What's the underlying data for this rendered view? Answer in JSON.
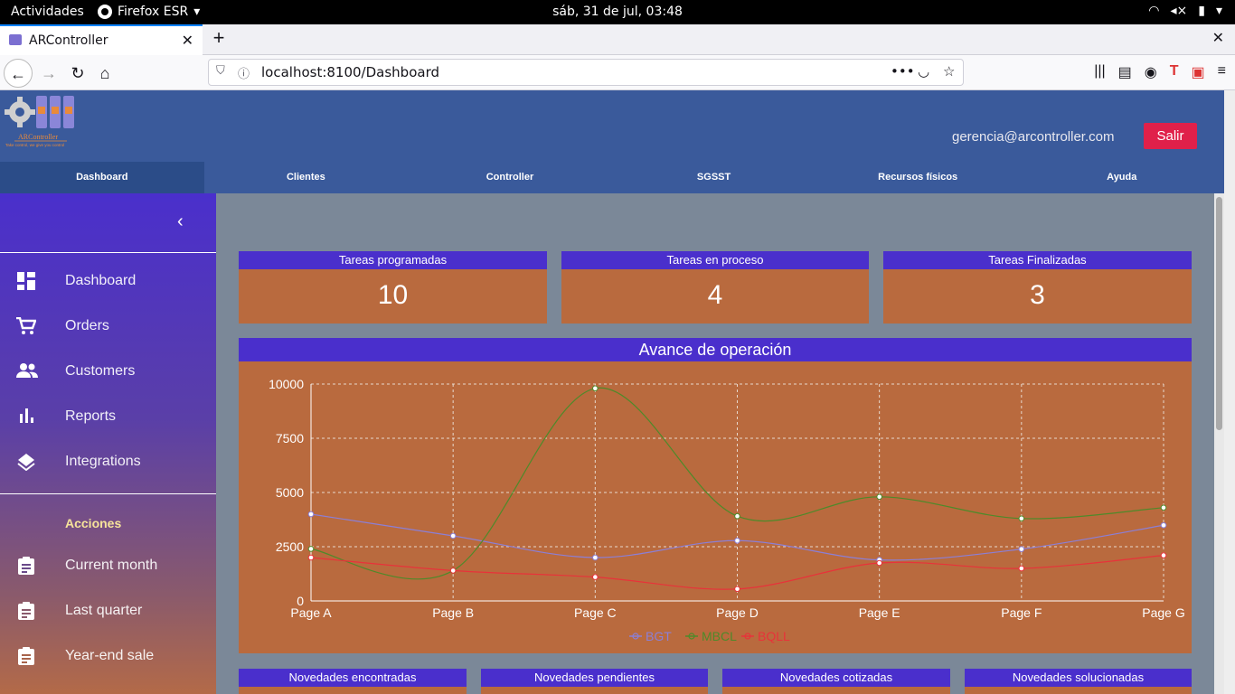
{
  "system": {
    "activities": "Actividades",
    "app_menu": "Firefox ESR",
    "clock": "sáb, 31 de jul, 03:48"
  },
  "browser": {
    "tab_title": "ARController",
    "url": "localhost:8100/Dashboard"
  },
  "header": {
    "logo_text": "ARController",
    "logo_tagline": "Take control, we give you control",
    "user_email": "gerencia@arcontroller.com",
    "logout_label": "Salir",
    "nav": [
      {
        "label": "Dashboard",
        "active": true
      },
      {
        "label": "Clientes"
      },
      {
        "label": "Controller"
      },
      {
        "label": "SGSST"
      },
      {
        "label": "Recursos físicos"
      },
      {
        "label": "Ayuda"
      }
    ]
  },
  "sidebar": {
    "items": [
      {
        "label": "Dashboard",
        "icon": "dashboard-icon"
      },
      {
        "label": "Orders",
        "icon": "cart-icon"
      },
      {
        "label": "Customers",
        "icon": "people-icon"
      },
      {
        "label": "Reports",
        "icon": "bar-chart-icon"
      },
      {
        "label": "Integrations",
        "icon": "layers-icon"
      }
    ],
    "section_title": "Acciones",
    "actions": [
      {
        "label": "Current month",
        "icon": "clipboard-icon"
      },
      {
        "label": "Last quarter",
        "icon": "clipboard-icon"
      },
      {
        "label": "Year-end sale",
        "icon": "clipboard-icon"
      }
    ]
  },
  "stats": [
    {
      "title": "Tareas programadas",
      "value": "10"
    },
    {
      "title": "Tareas en proceso",
      "value": "4"
    },
    {
      "title": "Tareas Finalizadas",
      "value": "3"
    }
  ],
  "chart_title": "Avance de operación",
  "chart_data": {
    "type": "line",
    "categories": [
      "Page A",
      "Page B",
      "Page C",
      "Page D",
      "Page E",
      "Page F",
      "Page G"
    ],
    "ylim": [
      0,
      10000
    ],
    "yticks": [
      "0",
      "2500",
      "5000",
      "7500",
      "10000"
    ],
    "grid": true,
    "legend": "bottom",
    "series": [
      {
        "name": "BGT",
        "color": "#8b7fd6",
        "values": [
          4000,
          3000,
          2000,
          2780,
          1890,
          2390,
          3490
        ]
      },
      {
        "name": "MBCL",
        "color": "#4e8a2a",
        "values": [
          2400,
          1398,
          9800,
          3908,
          4800,
          3800,
          4300
        ]
      },
      {
        "name": "BQLL",
        "color": "#e8323a",
        "values": [
          2000,
          1400,
          1100,
          550,
          1750,
          1500,
          2100
        ]
      }
    ]
  },
  "novedades": [
    {
      "title": "Novedades encontradas"
    },
    {
      "title": "Novedades pendientes"
    },
    {
      "title": "Novedades cotizadas"
    },
    {
      "title": "Novedades solucionadas"
    }
  ]
}
